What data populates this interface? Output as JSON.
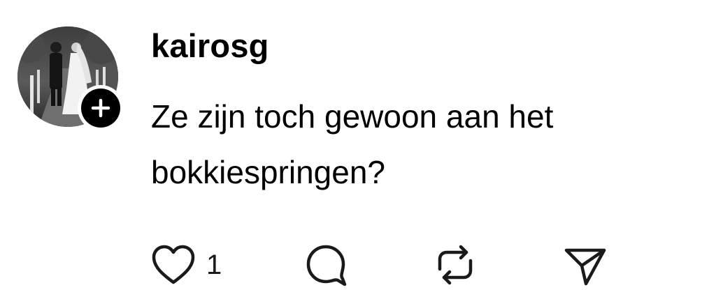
{
  "post": {
    "author": {
      "username": "kairosg",
      "avatar_icon": "wedding-couple-photo",
      "follow_icon": "plus-icon"
    },
    "text": "Ze zijn toch gewoon aan het\nbokkiespringen?",
    "actions": {
      "like": {
        "icon": "heart-icon",
        "count": "1"
      },
      "comment": {
        "icon": "comment-icon"
      },
      "repost": {
        "icon": "repost-icon"
      },
      "share": {
        "icon": "send-icon"
      }
    }
  }
}
